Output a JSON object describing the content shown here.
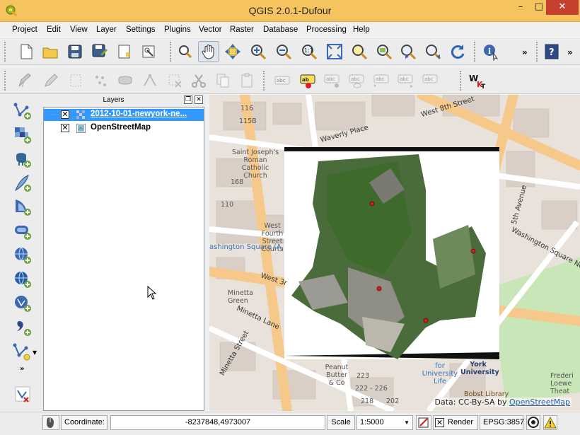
{
  "window": {
    "title": "QGIS 2.0.1-Dufour",
    "min": "–",
    "max": "□",
    "close": "✕"
  },
  "menu": [
    {
      "label": "Project",
      "key": "P"
    },
    {
      "label": "Edit",
      "key": "E"
    },
    {
      "label": "View",
      "key": "V"
    },
    {
      "label": "Layer",
      "key": "L"
    },
    {
      "label": "Settings",
      "key": "S"
    },
    {
      "label": "Plugins",
      "key": "P"
    },
    {
      "label": "Vector",
      "key": "o"
    },
    {
      "label": "Raster",
      "key": "R"
    },
    {
      "label": "Database",
      "key": "D"
    },
    {
      "label": "Processing",
      "key": "P"
    },
    {
      "label": "Help",
      "key": "H"
    }
  ],
  "toolbar": {
    "overflow": "»"
  },
  "layers_panel": {
    "title": "Layers",
    "float_btn": "❐",
    "close_btn": "✕",
    "layers": [
      {
        "name": "2012-10-01-newyork-ne...",
        "checked": "✕",
        "selected": true
      },
      {
        "name": "OpenStreetMap",
        "checked": "✕",
        "selected": false
      }
    ]
  },
  "map": {
    "labels": {
      "west_8th": "West 8th Street",
      "waverly": "Waverly Place",
      "fifth_ave": "5th Avenue",
      "wsq_north": "Washington Square North",
      "joseph": "Saint Joseph's Roman Catholic Church",
      "fourth_st": "West Fourth Street Courts",
      "wsq_park": "ashington Square (A,",
      "west3": "West 3r",
      "minetta_green": "Minetta Green",
      "minetta_lane": "Minetta Lane",
      "minetta_street": "Minetta Street",
      "peanut": "Peanut Butter & Co",
      "fu_life": "for University Life",
      "nyu": "York University",
      "bobst": "Bobst Library",
      "loewe": "Frederi Loewe Theat",
      "n115b": "115B",
      "n116": "116",
      "n110": "110",
      "n168": "168",
      "n222": "222 - 226",
      "n218": "218",
      "n202": "202",
      "n223": "223"
    },
    "attribution_prefix": "Data: CC-By-SA by ",
    "attribution_link": "OpenStreetMap"
  },
  "status": {
    "coordinate_label": "Coordinate:",
    "coordinate_value": "-8237848,4973007",
    "scale_label": "Scale",
    "scale_value": "1:5000",
    "render_checked": "✕",
    "render_label": "Render",
    "crs": "EPSG:3857"
  },
  "colors": {
    "titlebar": "#f6c45f",
    "selected_row": "#3399ff",
    "road_major": "#f6c98a",
    "park": "#c8e6b8"
  }
}
